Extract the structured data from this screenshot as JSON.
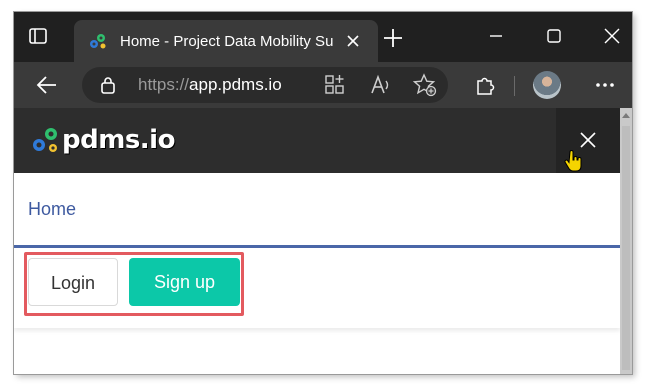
{
  "browser": {
    "tab_title": "Home - Project Data Mobility Su",
    "url_scheme": "https://",
    "url_host": "app.pdms.io"
  },
  "icons": {
    "window_menu": "window-icon",
    "favicon": "pdms-logo-icon",
    "tab_close": "close-icon",
    "new_tab": "plus-icon",
    "minimize": "minimize-icon",
    "maximize": "maximize-icon",
    "close_window": "close-icon",
    "back": "back-arrow-icon",
    "site_info": "lock-icon",
    "app_available": "apps-icon",
    "read_aloud": "read-aloud-icon",
    "favorites": "favorites-add-icon",
    "extensions": "puzzle-icon",
    "more": "more-icon",
    "menu_close": "close-icon"
  },
  "site": {
    "brand": "pdms.io",
    "nav": {
      "home": "Home"
    },
    "auth": {
      "login": "Login",
      "signup": "Sign up"
    }
  },
  "colors": {
    "header_bg": "#2d2d2d",
    "accent_teal": "#0cc8a8",
    "link_blue": "#3e5aa0",
    "highlight_red": "#e35a5f"
  }
}
